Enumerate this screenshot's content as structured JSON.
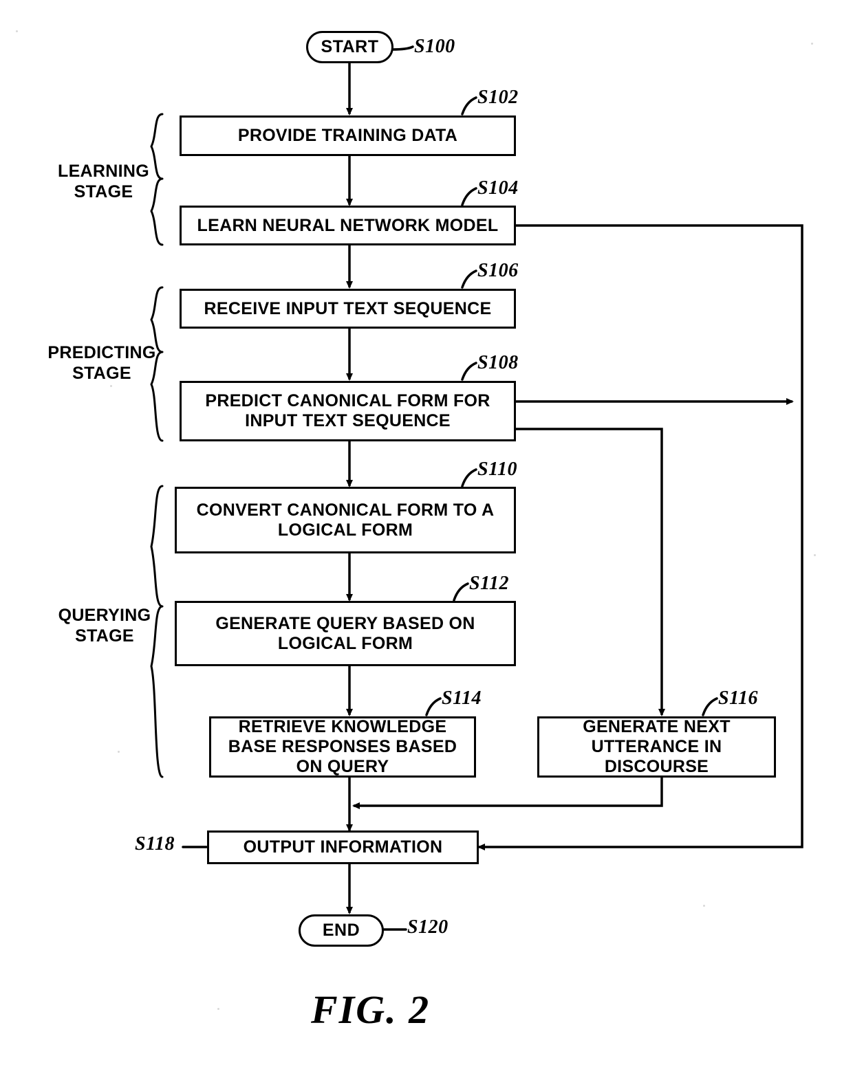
{
  "figure": {
    "caption": "FIG. 2"
  },
  "stages": [
    {
      "name": "learning-stage",
      "label": "LEARNING\nSTAGE"
    },
    {
      "name": "predicting-stage",
      "label": "PREDICTING\nSTAGE"
    },
    {
      "name": "querying-stage",
      "label": "QUERYING\nSTAGE"
    }
  ],
  "nodes": [
    {
      "name": "start-terminal",
      "label": "START",
      "step": "S100"
    },
    {
      "name": "provide-training-data",
      "label": "PROVIDE TRAINING DATA",
      "step": "S102"
    },
    {
      "name": "learn-neural-network-model",
      "label": "LEARN NEURAL NETWORK MODEL",
      "step": "S104"
    },
    {
      "name": "receive-input-text-sequence",
      "label": "RECEIVE INPUT TEXT SEQUENCE",
      "step": "S106"
    },
    {
      "name": "predict-canonical-form",
      "label": "PREDICT CANONICAL FORM FOR INPUT TEXT SEQUENCE",
      "step": "S108"
    },
    {
      "name": "convert-canonical-to-logical-form",
      "label": "CONVERT CANONICAL FORM TO A LOGICAL FORM",
      "step": "S110"
    },
    {
      "name": "generate-query",
      "label": "GENERATE QUERY BASED ON LOGICAL FORM",
      "step": "S112"
    },
    {
      "name": "retrieve-knowledge-base-responses",
      "label": "RETRIEVE KNOWLEDGE BASE RESPONSES BASED ON QUERY",
      "step": "S114"
    },
    {
      "name": "generate-next-utterance",
      "label": "GENERATE NEXT UTTERANCE IN DISCOURSE",
      "step": "S116"
    },
    {
      "name": "output-information",
      "label": "OUTPUT INFORMATION",
      "step": "S118"
    },
    {
      "name": "end-terminal",
      "label": "END",
      "step": "S120"
    }
  ],
  "chart_data": {
    "type": "table",
    "title": "FIG. 2",
    "categories": [
      "S100",
      "S102",
      "S104",
      "S106",
      "S108",
      "S110",
      "S112",
      "S114",
      "S116",
      "S118",
      "S120"
    ],
    "values": [
      "START",
      "PROVIDE TRAINING DATA",
      "LEARN NEURAL NETWORK MODEL",
      "RECEIVE INPUT TEXT SEQUENCE",
      "PREDICT CANONICAL FORM FOR INPUT TEXT SEQUENCE",
      "CONVERT CANONICAL FORM TO A LOGICAL FORM",
      "GENERATE QUERY BASED ON LOGICAL FORM",
      "RETRIEVE KNOWLEDGE BASE RESPONSES BASED ON QUERY",
      "GENERATE NEXT UTTERANCE IN DISCOURSE",
      "OUTPUT INFORMATION",
      "END"
    ]
  }
}
